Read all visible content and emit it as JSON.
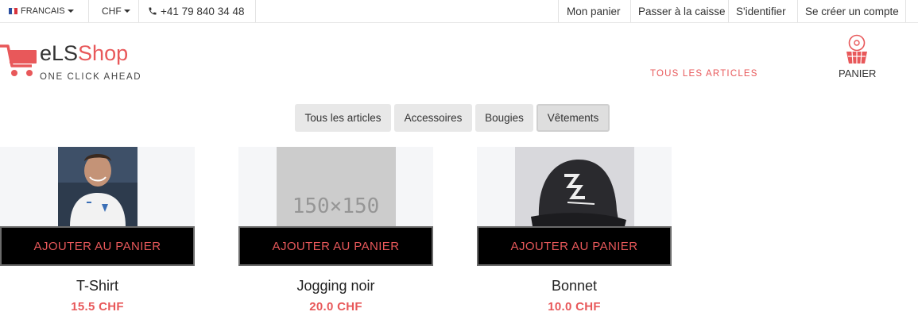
{
  "topbar": {
    "language": "FRANCAIS",
    "currency": "CHF",
    "phone": "+41 79 840 34 48",
    "links": [
      "Mon panier",
      "Passer à la caisse",
      "S'identifier",
      "Se créer un compte"
    ]
  },
  "brand": {
    "name_prefix": "eLS",
    "name_suffix": "Shop",
    "tagline": "ONE CLICK AHEAD"
  },
  "nav": {
    "all_items": "TOUS LES ARTICLES",
    "cart": "PANIER"
  },
  "filters": [
    "Tous les articles",
    "Accessoires",
    "Bougies",
    "Vêtements"
  ],
  "active_filter": "Vêtements",
  "products": [
    {
      "name": "T-Shirt",
      "price": "15.5 CHF",
      "button": "AJOUTER AU PANIER"
    },
    {
      "name": "Jogging noir",
      "price": "20.0 CHF",
      "button": "AJOUTER AU PANIER",
      "placeholder": "150×150"
    },
    {
      "name": "Bonnet",
      "price": "10.0 CHF",
      "button": "AJOUTER AU PANIER"
    }
  ],
  "colors": {
    "accent": "#e8585a",
    "button_bg": "#000000",
    "filter_bg": "#e8e8e8"
  }
}
